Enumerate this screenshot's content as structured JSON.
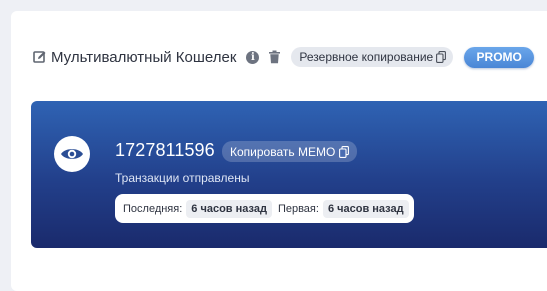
{
  "header": {
    "title": "Мультивалютный Кошелек",
    "backup_label": "Резервное копирование",
    "promo_label": "PROMO",
    "icons": {
      "edit": "edit-icon",
      "info": "info-icon",
      "trash": "trash-icon",
      "copy": "copy-icon"
    },
    "info_glyph": "i"
  },
  "card": {
    "address": "1727811596",
    "copy_memo_label": "Копировать MEMO",
    "status": "Транзакции отправлены",
    "last_label": "Последняя:",
    "last_value": "6 часов назад",
    "first_label": "Первая:",
    "first_value": "6 часов назад",
    "icon": "eye-icon"
  },
  "colors": {
    "card_top": "#2f63b4",
    "card_bottom": "#1a2a6c",
    "promo": "#4a86d6"
  }
}
